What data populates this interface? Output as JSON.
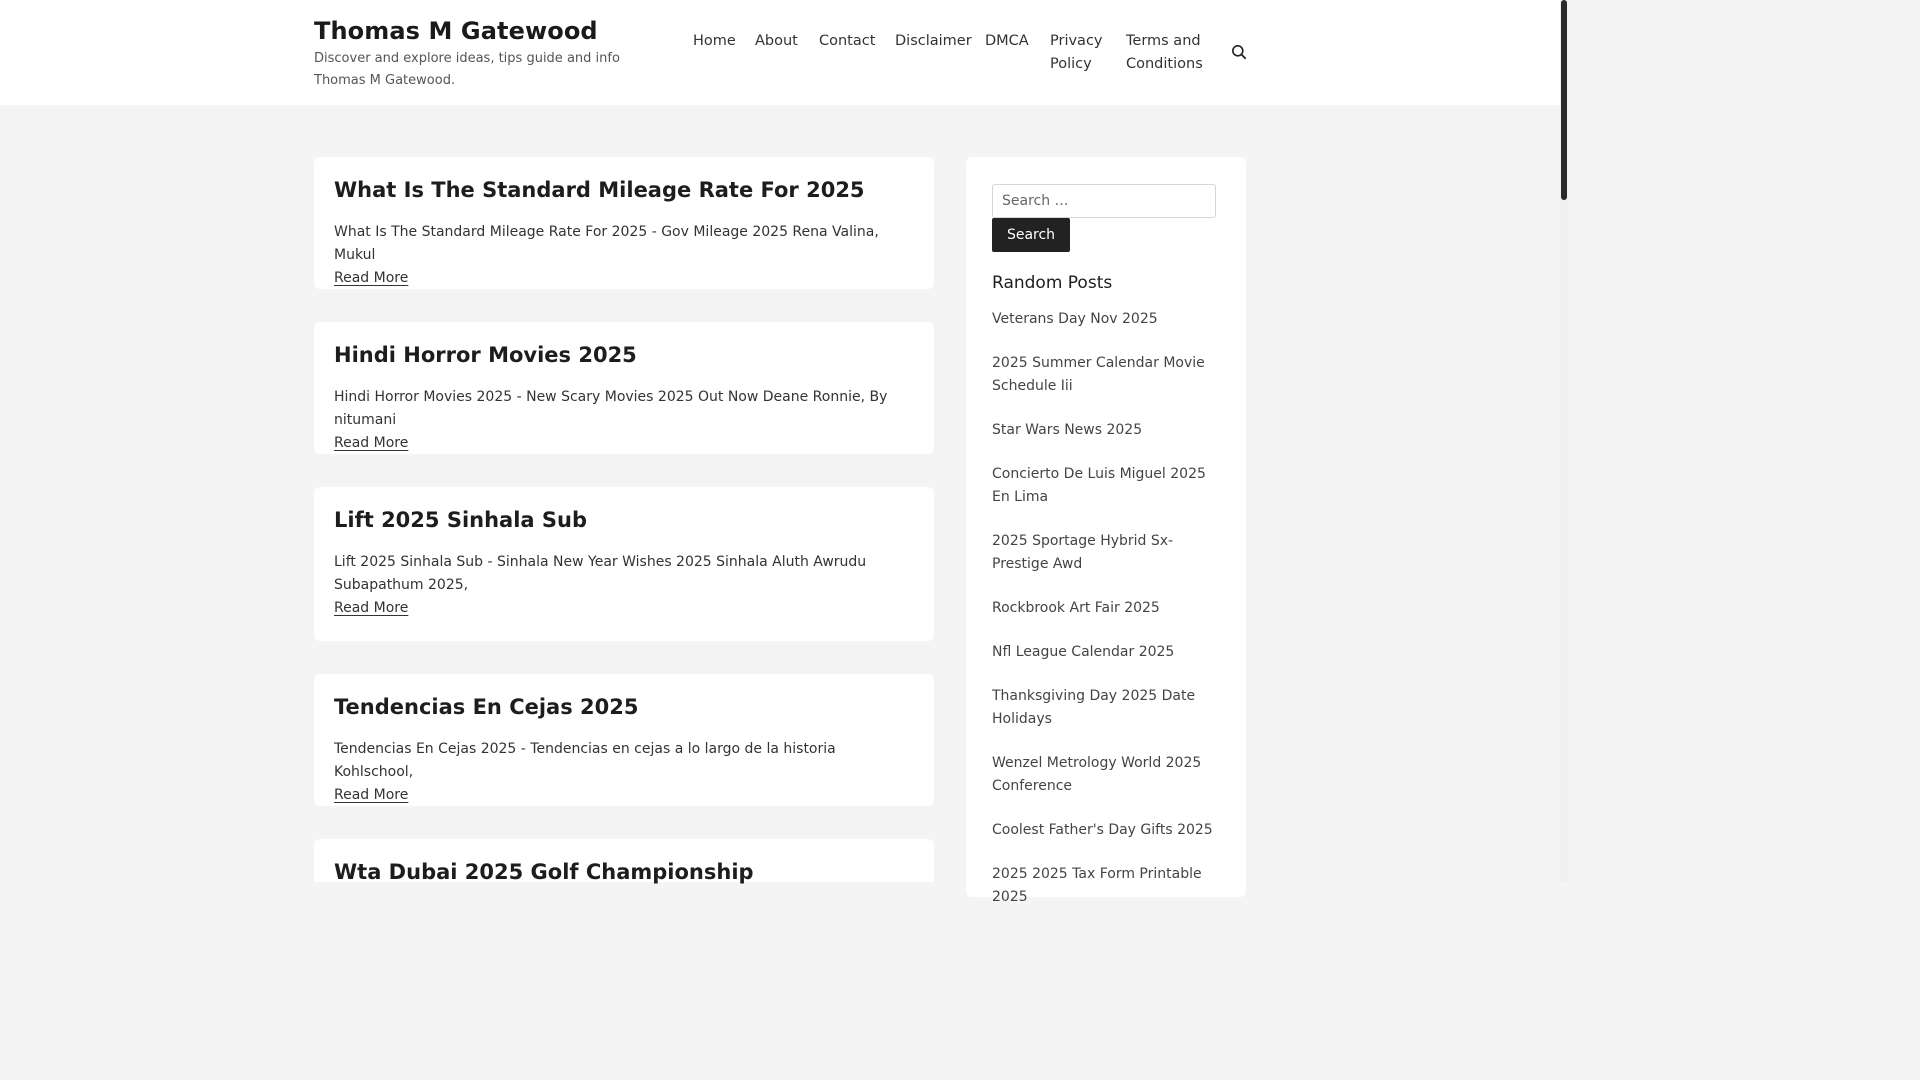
{
  "site": {
    "title": "Thomas M Gatewood",
    "description": "Discover and explore ideas, tips guide and info Thomas M Gatewood."
  },
  "nav": {
    "items": [
      "Home",
      "About",
      "Contact",
      "Disclaimer",
      "DMCA",
      "Privacy Policy",
      "Terms and Conditions"
    ],
    "search_icon": "search-icon"
  },
  "posts": [
    {
      "title": "What Is The Standard Mileage Rate For 2025",
      "excerpt": "What Is The Standard Mileage Rate For 2025 - Gov Mileage 2025 Rena Valina, Mukul",
      "read_more": "Read More"
    },
    {
      "title": "Hindi Horror Movies 2025",
      "excerpt": "Hindi Horror Movies 2025 - New Scary Movies 2025 Out Now Deane Ronnie, By nitumani",
      "read_more": "Read More"
    },
    {
      "title": "Lift 2025 Sinhala Sub",
      "excerpt": "Lift 2025 Sinhala Sub - Sinhala New Year Wishes 2025 Sinhala Aluth Awrudu Subapathum 2025,",
      "read_more": "Read More"
    },
    {
      "title": "Tendencias En Cejas 2025",
      "excerpt": "Tendencias En Cejas 2025 - Tendencias en cejas a lo largo de la historia Kohlschool,",
      "read_more": "Read More"
    },
    {
      "title": "Wta Dubai 2025 Golf Championship",
      "excerpt": "",
      "read_more": ""
    }
  ],
  "sidebar": {
    "search_placeholder": "Search …",
    "search_button": "Search",
    "random_title": "Random Posts",
    "random_posts": [
      "Veterans Day Nov 2025",
      "2025 Summer Calendar Movie Schedule Iii",
      "Star Wars News 2025",
      "Concierto De Luis Miguel 2025 En Lima",
      "2025 Sportage Hybrid Sx-Prestige Awd",
      "Rockbrook Art Fair 2025",
      "Nfl League Calendar 2025",
      "Thanksgiving Day 2025 Date Holidays",
      "Wenzel Metrology World 2025 Conference",
      "Coolest Father's Day Gifts 2025",
      "2025 2025 Tax Form Printable 2025"
    ]
  }
}
